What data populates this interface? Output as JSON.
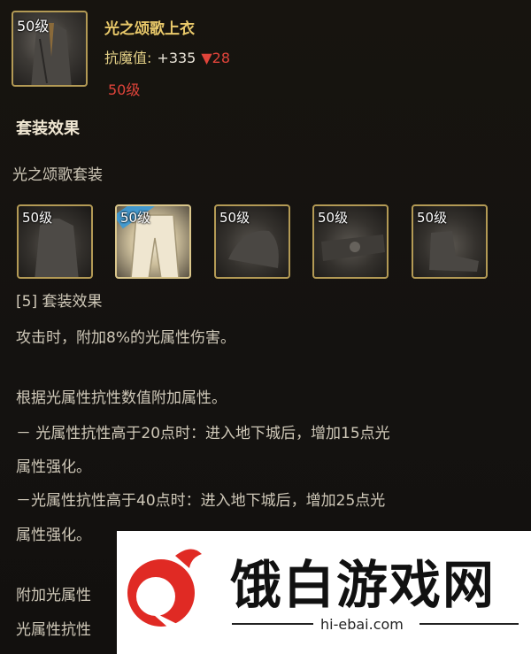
{
  "item": {
    "level_badge": "50级",
    "title": "光之颂歌上衣",
    "resist_label": "抗魔值:",
    "resist_value": "+335",
    "resist_down": "▼28",
    "required_level": "50级"
  },
  "set_effect_heading": "套装效果",
  "set_name": "光之颂歌套装",
  "set_pieces": [
    {
      "level_badge": "50级",
      "icon": "coat-icon"
    },
    {
      "level_badge": "50级",
      "icon": "pants-icon"
    },
    {
      "level_badge": "50级",
      "icon": "shoulder-icon"
    },
    {
      "level_badge": "50级",
      "icon": "belt-icon"
    },
    {
      "level_badge": "50级",
      "icon": "shoes-icon"
    }
  ],
  "description_lines": [
    "[5] 套装效果",
    "攻击时，附加8%的光属性伤害。",
    "根据光属性抗性数值附加属性。",
    "－ 光属性抗性高于20点时：进入地下城后，增加15点光",
    "属性强化。",
    "－光属性抗性高于40点时：进入地下城后，增加25点光",
    "属性强化。",
    "附加光属性",
    "光属性抗性"
  ],
  "watermark": {
    "brand": "饿白游戏网",
    "url": "hi-ebai.com"
  },
  "colors": {
    "gold_title": "#e9c96a",
    "red": "#e0443a",
    "frame": "#b39a55",
    "text": "#cfc8b8"
  }
}
